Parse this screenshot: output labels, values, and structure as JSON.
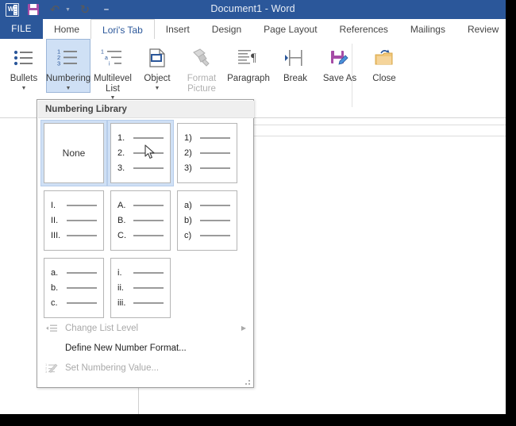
{
  "window": {
    "title": "Document1 - Word",
    "accent_color": "#2b579a"
  },
  "quick_access": {
    "items": [
      {
        "name": "word-logo",
        "label": "W"
      },
      {
        "name": "save",
        "label": "Save"
      },
      {
        "name": "undo",
        "label": "Undo"
      },
      {
        "name": "redo",
        "label": "Redo"
      },
      {
        "name": "customize",
        "label": "Customize Quick Access Toolbar"
      }
    ]
  },
  "ribbon": {
    "file_tab": "FILE",
    "tabs": [
      {
        "label": "Home",
        "active": false
      },
      {
        "label": "Lori's Tab",
        "active": true
      },
      {
        "label": "Insert",
        "active": false
      },
      {
        "label": "Design",
        "active": false
      },
      {
        "label": "Page Layout",
        "active": false
      },
      {
        "label": "References",
        "active": false
      },
      {
        "label": "Mailings",
        "active": false
      },
      {
        "label": "Review",
        "active": false
      }
    ],
    "buttons": [
      {
        "label": "Bullets",
        "icon": "bullets-icon",
        "has_caret": true,
        "selected": false,
        "disabled": false
      },
      {
        "label": "Numbering",
        "icon": "numbering-icon",
        "has_caret": true,
        "selected": true,
        "disabled": false
      },
      {
        "label": "Multilevel List",
        "icon": "multilevel-list-icon",
        "has_caret": true,
        "selected": false,
        "disabled": false
      },
      {
        "label": "Object",
        "icon": "object-icon",
        "has_caret": true,
        "selected": false,
        "disabled": false
      },
      {
        "label": "Format Picture",
        "icon": "format-picture-icon",
        "has_caret": false,
        "selected": false,
        "disabled": true
      },
      {
        "label": "Paragraph",
        "icon": "paragraph-icon",
        "has_caret": false,
        "selected": false,
        "disabled": false
      },
      {
        "label": "Break",
        "icon": "break-icon",
        "has_caret": false,
        "selected": false,
        "disabled": false
      },
      {
        "label": "Save As",
        "icon": "save-as-icon",
        "has_caret": false,
        "selected": false,
        "disabled": false
      },
      {
        "label": "Close",
        "icon": "close-icon",
        "has_caret": false,
        "selected": false,
        "disabled": false
      }
    ]
  },
  "numbering_dropdown": {
    "header": "Numbering Library",
    "highlight_color": "#cfe0f5",
    "tiles": [
      {
        "name": "none",
        "none_label": "None",
        "markers": [],
        "selected": true,
        "hovered": false
      },
      {
        "name": "decimal-period",
        "none_label": "",
        "markers": [
          "1.",
          "2.",
          "3."
        ],
        "selected": false,
        "hovered": true
      },
      {
        "name": "decimal-paren",
        "none_label": "",
        "markers": [
          "1)",
          "2)",
          "3)"
        ],
        "selected": false,
        "hovered": false
      },
      {
        "name": "upper-roman",
        "none_label": "",
        "markers": [
          "I.",
          "II.",
          "III."
        ],
        "selected": false,
        "hovered": false
      },
      {
        "name": "upper-alpha",
        "none_label": "",
        "markers": [
          "A.",
          "B.",
          "C."
        ],
        "selected": false,
        "hovered": false
      },
      {
        "name": "lower-alpha-paren",
        "none_label": "",
        "markers": [
          "a)",
          "b)",
          "c)"
        ],
        "selected": false,
        "hovered": false
      },
      {
        "name": "lower-alpha-period",
        "none_label": "",
        "markers": [
          "a.",
          "b.",
          "c."
        ],
        "selected": false,
        "hovered": false
      },
      {
        "name": "lower-roman",
        "none_label": "",
        "markers": [
          "i.",
          "ii.",
          "iii."
        ],
        "selected": false,
        "hovered": false
      }
    ],
    "menu_items": [
      {
        "label": "Change List Level",
        "icon": "change-list-level-icon",
        "disabled": true,
        "submenu": true,
        "accel": "C"
      },
      {
        "label": "Define New Number Format...",
        "icon": "",
        "disabled": false,
        "submenu": false,
        "accel": "D"
      },
      {
        "label": "Set Numbering Value...",
        "icon": "set-numbering-value-icon",
        "disabled": true,
        "submenu": false,
        "accel": "V"
      }
    ]
  }
}
